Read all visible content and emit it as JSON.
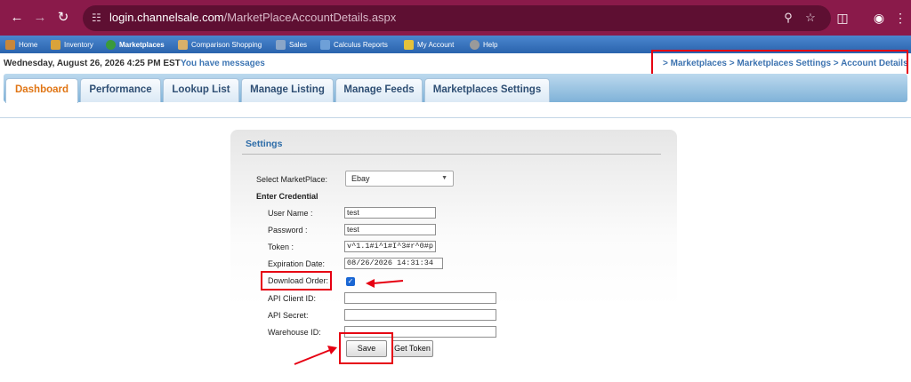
{
  "browser": {
    "url_domain": "login.channelsale.com",
    "url_path": "/MarketPlaceAccountDetails.aspx"
  },
  "menu": [
    {
      "label": "Home",
      "icon": "home-icon",
      "color": "#c8873a"
    },
    {
      "label": "Inventory",
      "icon": "inventory-icon",
      "color": "#d9a33a"
    },
    {
      "label": "Marketplaces",
      "icon": "globe-icon",
      "color": "#3a9a3a"
    },
    {
      "label": "Comparison Shopping",
      "icon": "shopping-icon",
      "color": "#d8b06a"
    },
    {
      "label": "Sales",
      "icon": "sales-icon",
      "color": "#8aa6c8"
    },
    {
      "label": "Calculus Reports",
      "icon": "report-icon",
      "color": "#6ea0d8"
    },
    {
      "label": "My Account",
      "icon": "account-icon",
      "color": "#e5c23a"
    },
    {
      "label": "Help",
      "icon": "help-icon",
      "color": "#9a9a9a"
    }
  ],
  "info": {
    "datetime": "Wednesday, August 26, 2026 4:25 PM EST",
    "messages": "You have messages",
    "breadcrumb_prefix": ">",
    "breadcrumb": [
      "Marketplaces",
      "Marketplaces Settings",
      "Account Details"
    ],
    "breadcrumb_sep": ">"
  },
  "tabs": [
    {
      "label": "Dashboard",
      "active": true
    },
    {
      "label": "Performance",
      "active": false
    },
    {
      "label": "Lookup List",
      "active": false
    },
    {
      "label": "Manage Listing",
      "active": false
    },
    {
      "label": "Manage Feeds",
      "active": false
    },
    {
      "label": "Marketplaces Settings",
      "active": false
    }
  ],
  "settings": {
    "title": "Settings",
    "select_marketplace_label": "Select MarketPlace:",
    "select_marketplace_value": "Ebay",
    "enter_credential_label": "Enter Credential",
    "username_label": "User Name :",
    "username_value": "test",
    "password_label": "Password :",
    "password_value": "test",
    "token_label": "Token :",
    "token_value": "v^1.1#i^1#I^3#r^0#p",
    "expiration_label": "Expiration Date:",
    "expiration_value": "08/26/2026 14:31:34",
    "download_order_label": "Download Order:",
    "download_order_checked": true,
    "api_client_id_label": "API Client ID:",
    "api_client_id_value": "",
    "api_secret_label": "API Secret:",
    "api_secret_value": "",
    "warehouse_id_label": "Warehouse ID:",
    "warehouse_id_value": "",
    "save_label": "Save",
    "get_token_label": "Get Token"
  },
  "colors": {
    "annotation_red": "#e60012",
    "accent_blue": "#2d6ca8",
    "active_tab_orange": "#e07514"
  }
}
